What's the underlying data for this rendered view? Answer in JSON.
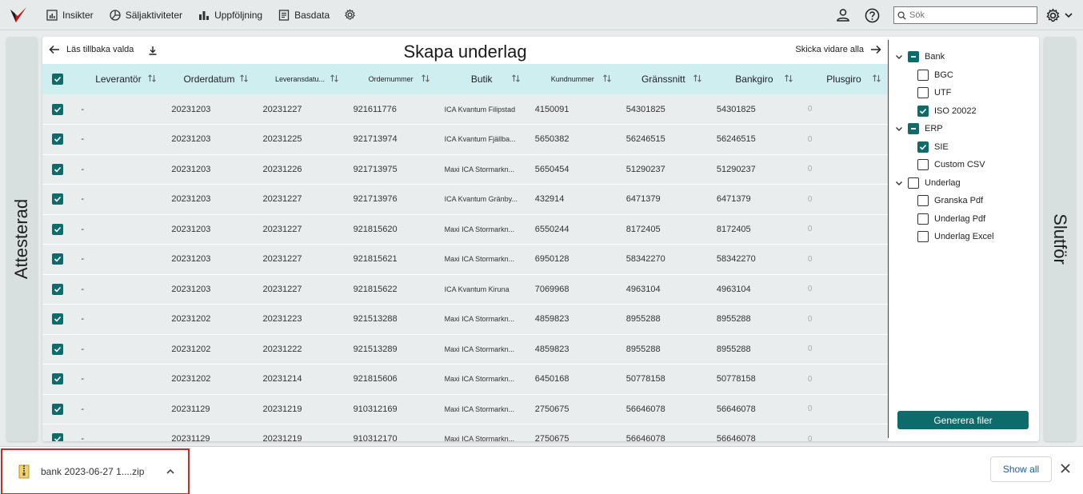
{
  "nav": {
    "items": [
      {
        "label": "Insikter",
        "icon": "bar-chart-box-icon"
      },
      {
        "label": "Säljaktiviteter",
        "icon": "pie-chart-icon"
      },
      {
        "label": "Uppföljning",
        "icon": "bar-chart-icon"
      },
      {
        "label": "Basdata",
        "icon": "document-icon"
      }
    ],
    "search_placeholder": "Sök"
  },
  "side": {
    "left": "Attesterad",
    "right": "Slutför"
  },
  "panel": {
    "title": "Skapa underlag",
    "back_label": "Läs tillbaka valda",
    "forward_label": "Skicka vidare alla"
  },
  "table": {
    "columns": [
      "Leverantör",
      "Orderdatum",
      "Leveransdatu...",
      "Ordernummer",
      "Butik",
      "Kundnummer",
      "Gränssnitt",
      "Bankgiro",
      "Plusgiro"
    ],
    "rows": [
      [
        "-",
        "20231203",
        "20231227",
        "921611776",
        "ICA Kvantum Filipstad",
        "4150091",
        "54301825",
        "54301825",
        "0"
      ],
      [
        "-",
        "20231203",
        "20231225",
        "921713974",
        "ICA Kvantum Fjällba...",
        "5650382",
        "56246515",
        "56246515",
        "0"
      ],
      [
        "-",
        "20231203",
        "20231226",
        "921713975",
        "Maxi ICA Stormarkn...",
        "5650454",
        "51290237",
        "51290237",
        "0"
      ],
      [
        "-",
        "20231203",
        "20231227",
        "921713976",
        "ICA Kvantum Gränby...",
        "432914",
        "6471379",
        "6471379",
        "0"
      ],
      [
        "-",
        "20231203",
        "20231227",
        "921815620",
        "Maxi ICA Stormarkn...",
        "6550244",
        "8172405",
        "8172405",
        "0"
      ],
      [
        "-",
        "20231203",
        "20231227",
        "921815621",
        "Maxi ICA Stormarkn...",
        "6950128",
        "58342270",
        "58342270",
        "0"
      ],
      [
        "-",
        "20231203",
        "20231227",
        "921815622",
        "ICA Kvantum Kiruna",
        "7069968",
        "4963104",
        "4963104",
        "0"
      ],
      [
        "-",
        "20231202",
        "20231223",
        "921513288",
        "Maxi ICA Stormarkn...",
        "4859823",
        "8955288",
        "8955288",
        "0"
      ],
      [
        "-",
        "20231202",
        "20231222",
        "921513289",
        "Maxi ICA Stormarkn...",
        "4859823",
        "8955288",
        "8955288",
        "0"
      ],
      [
        "-",
        "20231202",
        "20231214",
        "921815606",
        "Maxi ICA Stormarkn...",
        "6450168",
        "50778158",
        "50778158",
        "0"
      ],
      [
        "-",
        "20231129",
        "20231219",
        "910312169",
        "Maxi ICA Stormarkn...",
        "2750675",
        "56646078",
        "56646078",
        "0"
      ],
      [
        "-",
        "20231129",
        "20231219",
        "910312170",
        "Maxi ICA Stormarkn...",
        "2750675",
        "56646078",
        "56646078",
        "0"
      ]
    ]
  },
  "options": {
    "groups": [
      {
        "label": "Bank",
        "state": "partial",
        "children": [
          {
            "label": "BGC",
            "checked": false
          },
          {
            "label": "UTF",
            "checked": false
          },
          {
            "label": "ISO 20022",
            "checked": true
          }
        ]
      },
      {
        "label": "ERP",
        "state": "partial",
        "children": [
          {
            "label": "SIE",
            "checked": true
          },
          {
            "label": "Custom CSV",
            "checked": false
          }
        ]
      },
      {
        "label": "Underlag",
        "state": "none",
        "children": [
          {
            "label": "Granska Pdf",
            "checked": false
          },
          {
            "label": "Underlag Pdf",
            "checked": false
          },
          {
            "label": "Underlag Excel",
            "checked": false
          }
        ]
      }
    ],
    "generate_label": "Generera filer"
  },
  "download": {
    "filename": "bank 2023-06-27 1....zip",
    "show_all": "Show all"
  },
  "colors": {
    "accent": "#0d6b6b",
    "header_bg": "#cfeef0",
    "row_bg": "#eaeded",
    "highlight": "#e02020"
  }
}
